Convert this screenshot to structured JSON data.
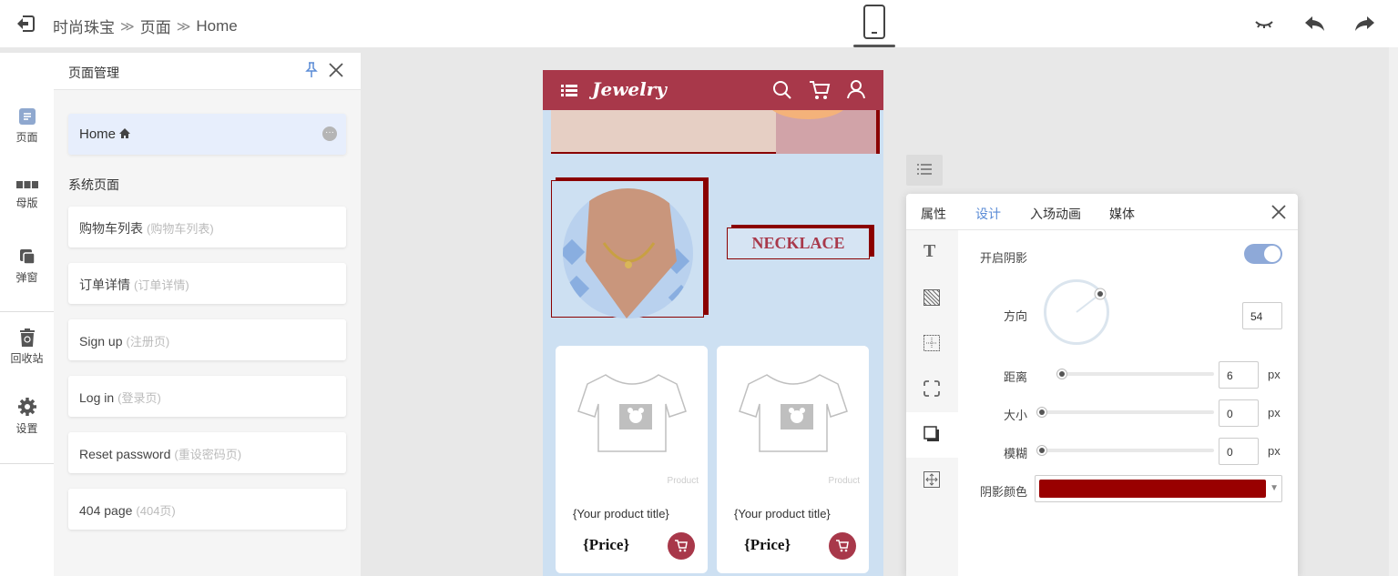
{
  "breadcrumb": {
    "project": "时尚珠宝",
    "section": "页面",
    "page": "Home"
  },
  "leftnav": {
    "items": [
      {
        "key": "pages",
        "label": "页面"
      },
      {
        "key": "master",
        "label": "母版"
      },
      {
        "key": "popup",
        "label": "弹窗"
      },
      {
        "key": "recycle",
        "label": "回收站"
      },
      {
        "key": "settings",
        "label": "设置"
      }
    ]
  },
  "page_manager": {
    "title": "页面管理",
    "home": {
      "label": "Home",
      "more": "···"
    },
    "system_title": "系统页面",
    "system_pages": [
      {
        "name": "购物车列表",
        "sub": "(购物车列表)"
      },
      {
        "name": "订单详情",
        "sub": "(订单详情)"
      },
      {
        "name": "Sign up",
        "sub": "(注册页)"
      },
      {
        "name": "Log in",
        "sub": "(登录页)"
      },
      {
        "name": "Reset password",
        "sub": "(重设密码页)"
      },
      {
        "name": "404 page",
        "sub": "(404页)"
      }
    ]
  },
  "phone": {
    "logo": "Jewelry",
    "necklace_label": "NECKLACE",
    "products": [
      {
        "tag": "Product",
        "title": "{Your product title}",
        "price": "{Price}"
      },
      {
        "tag": "Product",
        "title": "{Your product title}",
        "price": "{Price}"
      }
    ]
  },
  "design_panel": {
    "tabs": [
      "属性",
      "设计",
      "入场动画",
      "媒体"
    ],
    "active_tab": "设计",
    "shadow_enable_label": "开启阴影",
    "shadow_enabled": true,
    "direction_label": "方向",
    "direction_value": "54",
    "distance_label": "距离",
    "distance_value": "6",
    "size_label": "大小",
    "size_value": "0",
    "blur_label": "模糊",
    "blur_value": "0",
    "unit": "px",
    "color_label": "阴影颜色",
    "shadow_color": "#990000"
  },
  "colors": {
    "brand": "#a8384a",
    "accent": "#5a8bd6",
    "canvas_bg": "#cde0f2"
  }
}
